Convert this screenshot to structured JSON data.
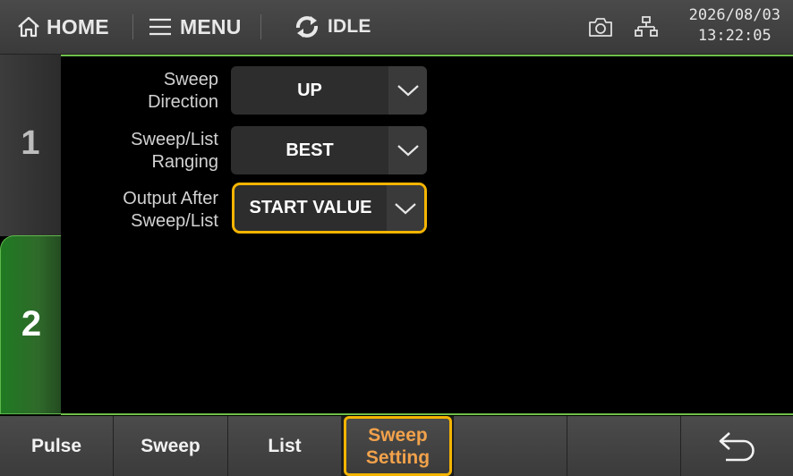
{
  "header": {
    "home_label": "HOME",
    "menu_label": "MENU",
    "state_label": "IDLE",
    "date": "2026/08/03",
    "time": "13:22:05"
  },
  "channels": [
    {
      "label": "1"
    },
    {
      "label": "2"
    }
  ],
  "settings": [
    {
      "label_line1": "Sweep",
      "label_line2": "Direction",
      "value": "UP"
    },
    {
      "label_line1": "Sweep/List",
      "label_line2": "Ranging",
      "value": "BEST"
    },
    {
      "label_line1": "Output After",
      "label_line2": "Sweep/List",
      "value": "START VALUE"
    }
  ],
  "softkeys": [
    {
      "label": "Pulse"
    },
    {
      "label": "Sweep"
    },
    {
      "label": "List"
    },
    {
      "label_line1": "Sweep",
      "label_line2": "Setting"
    },
    {
      "label": ""
    },
    {
      "label": ""
    }
  ],
  "colors": {
    "accent_green": "#6fbf4a",
    "focus_yellow": "#f4b400",
    "active_text": "#f2a24b"
  }
}
